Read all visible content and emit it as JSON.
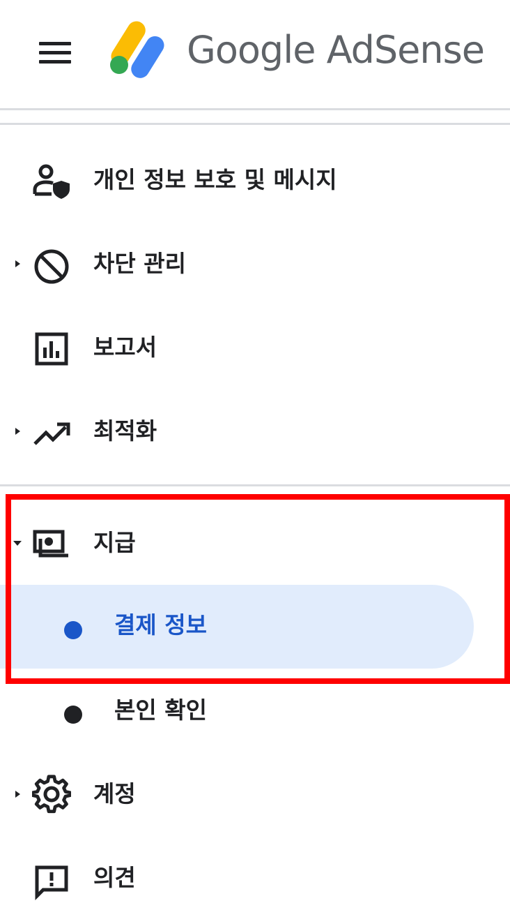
{
  "header": {
    "brand": "Google AdSense"
  },
  "nav": {
    "items": [
      {
        "label": "개인 정보 보호 및 메시지",
        "icon": "privacy-person-shield-icon"
      },
      {
        "label": "차단 관리",
        "icon": "block-icon",
        "expandable": true
      },
      {
        "label": "보고서",
        "icon": "bar-chart-icon"
      },
      {
        "label": "최적화",
        "icon": "trending-up-icon",
        "expandable": true
      },
      {
        "label": "지급",
        "icon": "payments-icon",
        "expanded": true,
        "children": [
          {
            "label": "결제 정보",
            "active": true
          },
          {
            "label": "본인 확인"
          }
        ]
      },
      {
        "label": "계정",
        "icon": "gear-icon",
        "expandable": true
      },
      {
        "label": "의견",
        "icon": "feedback-icon"
      }
    ]
  },
  "colors": {
    "active_bg": "#e1ecfc",
    "active_text": "#1a56c8",
    "highlight_border": "#ff0000",
    "logo_yellow": "#fbbc04",
    "logo_blue": "#4285f4",
    "logo_green": "#34a853"
  }
}
